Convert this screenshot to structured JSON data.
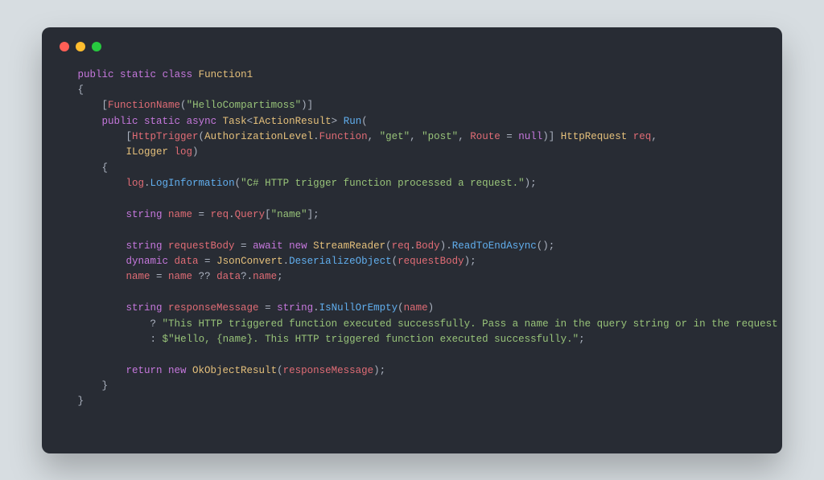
{
  "window": {
    "traffic": {
      "red": "#ff5f56",
      "yellow": "#ffbd2e",
      "green": "#27c93f"
    }
  },
  "code": {
    "l1": {
      "kw1": "public",
      "kw2": "static",
      "kw3": "class",
      "type": "Function1"
    },
    "l2": {
      "brace": "{"
    },
    "l3": {
      "lbr": "[",
      "attr": "FunctionName",
      "lp": "(",
      "str": "\"HelloCompartimoss\"",
      "rp": ")",
      "rbr": "]"
    },
    "l4": {
      "kw1": "public",
      "kw2": "static",
      "kw3": "async",
      "type1": "Task",
      "lt": "<",
      "type2": "IActionResult",
      "gt": ">",
      "fn": "Run",
      "lp": "("
    },
    "l5": {
      "lbr": "[",
      "attr": "HttpTrigger",
      "lp": "(",
      "enum": "AuthorizationLevel",
      "dot": ".",
      "member": "Function",
      "c1": ", ",
      "str1": "\"get\"",
      "c2": ", ",
      "str2": "\"post\"",
      "c3": ", ",
      "route": "Route",
      "eq": " = ",
      "null": "null",
      "rp": ")",
      "rbr": "] ",
      "type": "HttpRequest",
      "param": " req",
      "comma": ","
    },
    "l6": {
      "type": "ILogger",
      "param": " log",
      "rp": ")"
    },
    "l7": {
      "brace": "{"
    },
    "l8": {
      "obj": "log",
      "dot": ".",
      "fn": "LogInformation",
      "lp": "(",
      "str": "\"C# HTTP trigger function processed a request.\"",
      "rp": ")",
      "semi": ";"
    },
    "l10": {
      "type": "string",
      "id": " name",
      "eq": " = ",
      "obj": "req",
      "dot": ".",
      "prop": "Query",
      "idx": "[",
      "str": "\"name\"",
      "idx2": "]",
      "semi": ";"
    },
    "l12": {
      "type": "string",
      "id": " requestBody",
      "eq": " = ",
      "kw": "await",
      "kw2": " new ",
      "ctor": "StreamReader",
      "lp": "(",
      "obj": "req",
      "dot": ".",
      "prop": "Body",
      "rp": ")",
      "dot2": ".",
      "fn": "ReadToEndAsync",
      "lp2": "(",
      "rp2": ")",
      "semi": ";"
    },
    "l13": {
      "type": "dynamic",
      "id": " data",
      "eq": " = ",
      "cls": "JsonConvert",
      "dot": ".",
      "fn": "DeserializeObject",
      "lp": "(",
      "arg": "requestBody",
      "rp": ")",
      "semi": ";"
    },
    "l14": {
      "id": "name",
      "eq": " = ",
      "id2": "name",
      "op": " ?? ",
      "id3": "data",
      "op2": "?.",
      "prop": "name",
      "semi": ";"
    },
    "l16": {
      "type": "string",
      "id": " responseMessage",
      "eq": " = ",
      "cls": "string",
      "dot": ".",
      "fn": "IsNullOrEmpty",
      "lp": "(",
      "arg": "name",
      "rp": ")"
    },
    "l17": {
      "q": "? ",
      "str": "\"This HTTP triggered function executed successfully. Pass a name in the query string or in the request body for a personalized response.\""
    },
    "l18": {
      "c": ": ",
      "dollar": "$",
      "str": "\"Hello, {name}. This HTTP triggered function executed successfully.\"",
      "semi": ";"
    },
    "l20": {
      "kw": "return",
      "kw2": " new ",
      "ctor": "OkObjectResult",
      "lp": "(",
      "arg": "responseMessage",
      "rp": ")",
      "semi": ";"
    },
    "l21": {
      "brace": "}"
    },
    "l22": {
      "brace": "}"
    }
  }
}
